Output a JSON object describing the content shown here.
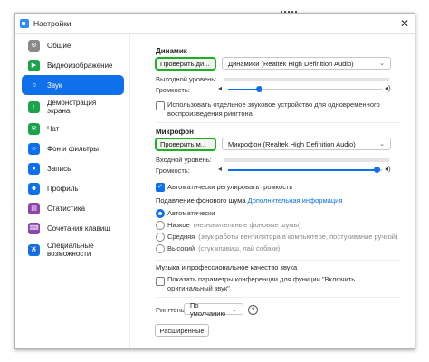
{
  "window": {
    "title": "Настройки",
    "close_label": "✕"
  },
  "sidebar": {
    "items": [
      {
        "label": "Общие",
        "icon": "gear-icon",
        "color": "#8a8a8a",
        "glyph": "⚙"
      },
      {
        "label": "Видеоизображение",
        "icon": "video-camera-icon",
        "color": "#1aa34a",
        "glyph": "▶"
      },
      {
        "label": "Звук",
        "icon": "headphones-icon",
        "color": "#0e71eb",
        "glyph": "♫",
        "active": true
      },
      {
        "label": "Демонстрация экрана",
        "icon": "screen-share-icon",
        "color": "#1aa34a",
        "glyph": "↑"
      },
      {
        "label": "Чат",
        "icon": "chat-icon",
        "color": "#1aa34a",
        "glyph": "✉"
      },
      {
        "label": "Фон и фильтры",
        "icon": "background-filters-icon",
        "color": "#0e71eb",
        "glyph": "☺"
      },
      {
        "label": "Запись",
        "icon": "record-icon",
        "color": "#0e71eb",
        "glyph": "●"
      },
      {
        "label": "Профиль",
        "icon": "profile-icon",
        "color": "#0e71eb",
        "glyph": "☻"
      },
      {
        "label": "Статистика",
        "icon": "statistics-icon",
        "color": "#8e44ad",
        "glyph": "▤"
      },
      {
        "label": "Сочетания клавиш",
        "icon": "keyboard-icon",
        "color": "#8e44ad",
        "glyph": "⌨"
      },
      {
        "label": "Специальные возможности",
        "icon": "accessibility-icon",
        "color": "#0e71eb",
        "glyph": "♿"
      }
    ]
  },
  "speaker": {
    "heading": "Динамик",
    "test_button": "Проверить ди...",
    "device": "Динамики (Realtek High Definition Audio)",
    "output_level_label": "Выходной уровень:",
    "volume_label": "Громкость:",
    "volume_level": 0.2
  },
  "separate_device": {
    "label": "Использовать отдельное звуковое устройство для одновременного воспроизведения рингтона",
    "checked": false
  },
  "microphone": {
    "heading": "Микрофон",
    "test_button": "Проверить м...",
    "device": "Микрофон (Realtek High Definition Audio)",
    "input_level_label": "Входной уровень:",
    "volume_label": "Громкость:",
    "volume_level": 0.97
  },
  "auto_volume": {
    "label": "Автоматически регулировать громкость",
    "checked": true
  },
  "noise": {
    "heading": "Подавление фонового шума",
    "more_link": "Дополнительная информация",
    "options": [
      {
        "label": "Автоматически",
        "hint": "",
        "selected": true
      },
      {
        "label": "Низкое",
        "hint": "(незначительные фоновые шумы)",
        "selected": false
      },
      {
        "label": "Средняя",
        "hint": "(звук работы вентилятора в компьютере, постукивание ручкой)",
        "selected": false
      },
      {
        "label": "Высокий",
        "hint": "(стук клавиш, лай собаки)",
        "selected": false
      }
    ]
  },
  "music": {
    "heading": "Музыка и профессиональное качество звука",
    "show_option_label": "Показать параметры конференции для функции \"Включить оригинальный звук\"",
    "checked": false
  },
  "ringtones": {
    "label": "Рингтоны",
    "value": "По умолчанию",
    "help": "?"
  },
  "advanced_button": "Расширенные",
  "colors": {
    "accent": "#0e71eb",
    "highlight": "#19b31e"
  }
}
